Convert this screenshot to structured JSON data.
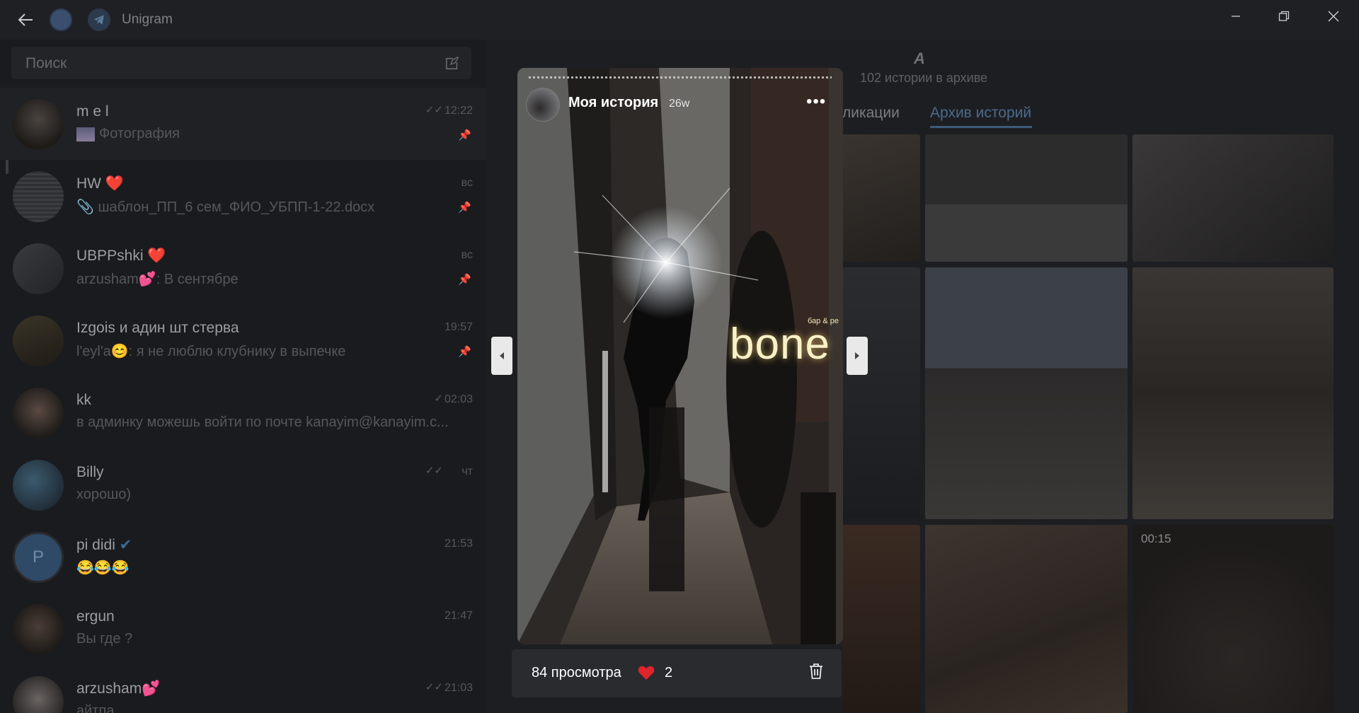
{
  "app": {
    "title": "Unigram"
  },
  "search": {
    "placeholder": "Поиск"
  },
  "chats": [
    {
      "name": "m e l",
      "preview": "Фотография",
      "time": "12:22",
      "pinned": true,
      "read": true
    },
    {
      "name": "HW ❤️",
      "preview": "📎 шаблон_ПП_6 сем_ФИО_УБПП-1-22.docx",
      "time": "вс",
      "pinned": true
    },
    {
      "name": "UBPPshki ❤️",
      "preview": "arzusham💕: В сентябре",
      "time": "вс",
      "pinned": true
    },
    {
      "name": "Izgois и адин шт стерва",
      "preview": "l'eyl'a😊: я не люблю клубнику в выпечке",
      "time": "19:57",
      "pinned": true
    },
    {
      "name": "kk",
      "preview": "в админку можешь войти по почте kanayim@kanayim.c...",
      "time": "02:03",
      "read": true
    },
    {
      "name": "Billy",
      "preview": "хорошо)",
      "time": "чт",
      "read": true
    },
    {
      "name": "pi didi",
      "preview": "😂😂😂",
      "time": "21:53"
    },
    {
      "name": "ergun",
      "preview": "Вы где ?",
      "time": "21:47"
    },
    {
      "name": "arzusham💕",
      "preview": "айтпа",
      "time": "21:03",
      "read": true
    }
  ],
  "archive": {
    "icon": "archive-icon",
    "count_text": "102 истории в архиве",
    "tabs": [
      {
        "label": "ликации"
      },
      {
        "label": "Архив историй",
        "active": true
      }
    ],
    "video_duration": "00:15"
  },
  "story": {
    "title": "Моя история",
    "age": "26w",
    "sign_text": "bone",
    "sign_small": "бар & ре",
    "views": "84 просмотра",
    "likes": "2"
  },
  "colors": {
    "accent": "#4a6a8c",
    "heart": "#e0242c",
    "background": "#1b1c20"
  }
}
